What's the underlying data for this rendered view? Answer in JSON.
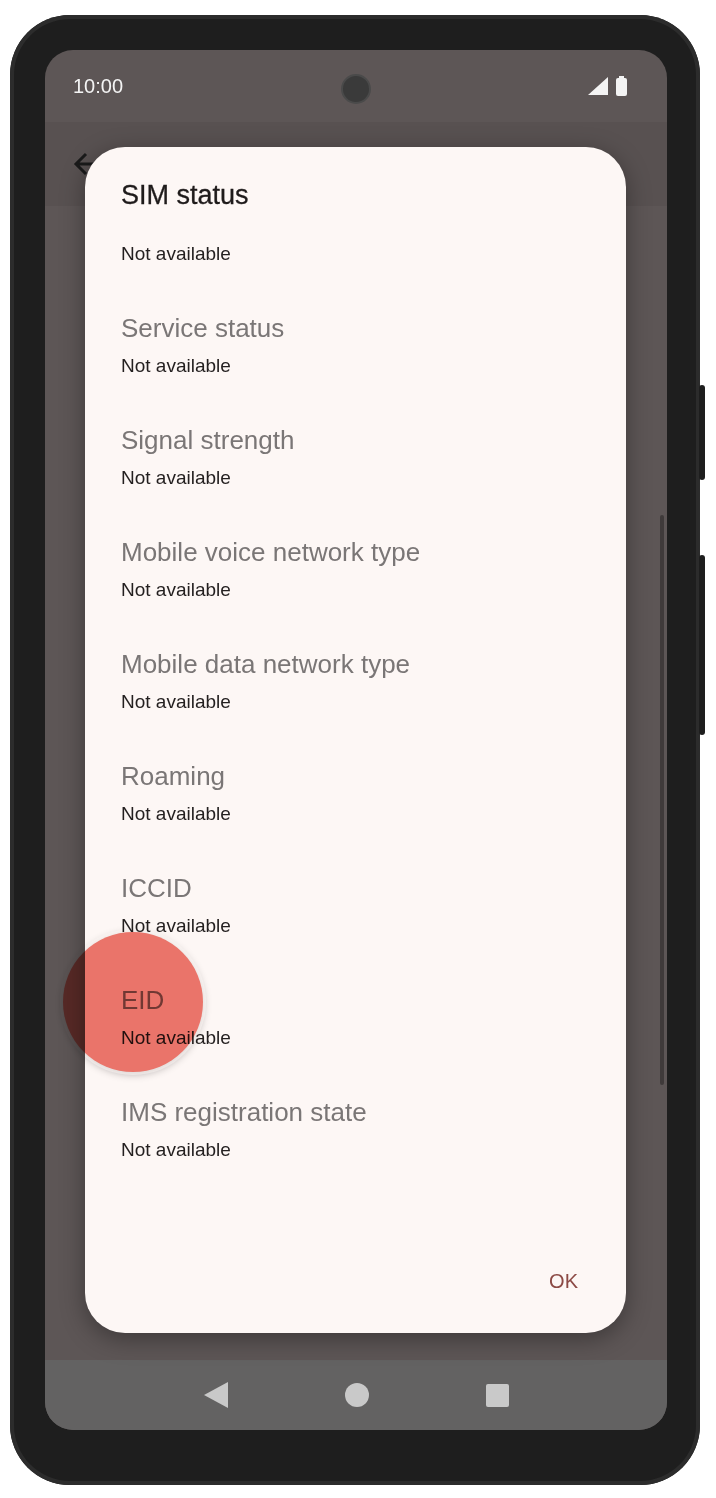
{
  "status_bar": {
    "time": "10:00"
  },
  "dialog": {
    "title": "SIM status",
    "items": [
      {
        "value": "Not available"
      },
      {
        "label": "Service status",
        "value": "Not available"
      },
      {
        "label": "Signal strength",
        "value": "Not available"
      },
      {
        "label": "Mobile voice network type",
        "value": "Not available"
      },
      {
        "label": "Mobile data network type",
        "value": "Not available"
      },
      {
        "label": "Roaming",
        "value": "Not available"
      },
      {
        "label": "ICCID",
        "value": "Not available"
      },
      {
        "label": "EID",
        "value": "Not available"
      },
      {
        "label": "IMS registration state",
        "value": "Not available"
      }
    ],
    "buttons": [
      "OK"
    ]
  }
}
